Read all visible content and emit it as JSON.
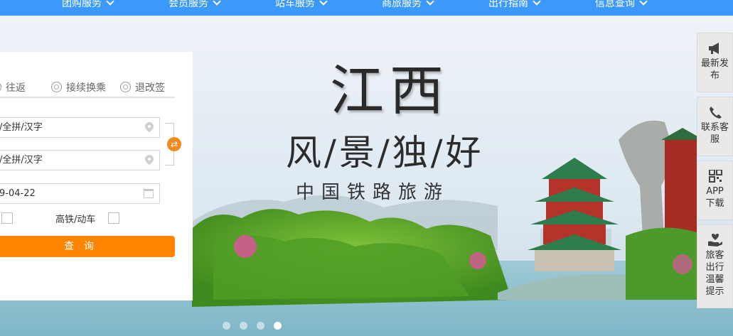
{
  "nav": {
    "items": [
      {
        "label": "团购服务"
      },
      {
        "label": "会员服务"
      },
      {
        "label": "站车服务"
      },
      {
        "label": "商旅服务"
      },
      {
        "label": "出行指南"
      },
      {
        "label": "信息查询"
      }
    ]
  },
  "booking": {
    "trip_options": [
      "往返",
      "接续换乘",
      "退改签"
    ],
    "from_placeholder": "/全拼/汉字",
    "to_placeholder": "/全拼/汉字",
    "date_value": "9-04-22",
    "highspeed_label": "高铁/动车",
    "search_label": "查询"
  },
  "banner": {
    "title": "江西",
    "subtitle": "风/景/独/好",
    "tagline": "中国铁路旅游"
  },
  "sidebar": {
    "items": [
      {
        "label": "最新发布",
        "icon": "megaphone-icon"
      },
      {
        "label": "联系客服",
        "icon": "phone-icon"
      },
      {
        "label": "APP下载",
        "icon": "qrcode-icon"
      },
      {
        "label": "旅客出行温馨提示",
        "icon": "hand-heart-icon"
      }
    ]
  },
  "carousel": {
    "count": 4,
    "active": 4
  },
  "colors": {
    "nav": "#3b99fc",
    "accent": "#ff8400"
  }
}
